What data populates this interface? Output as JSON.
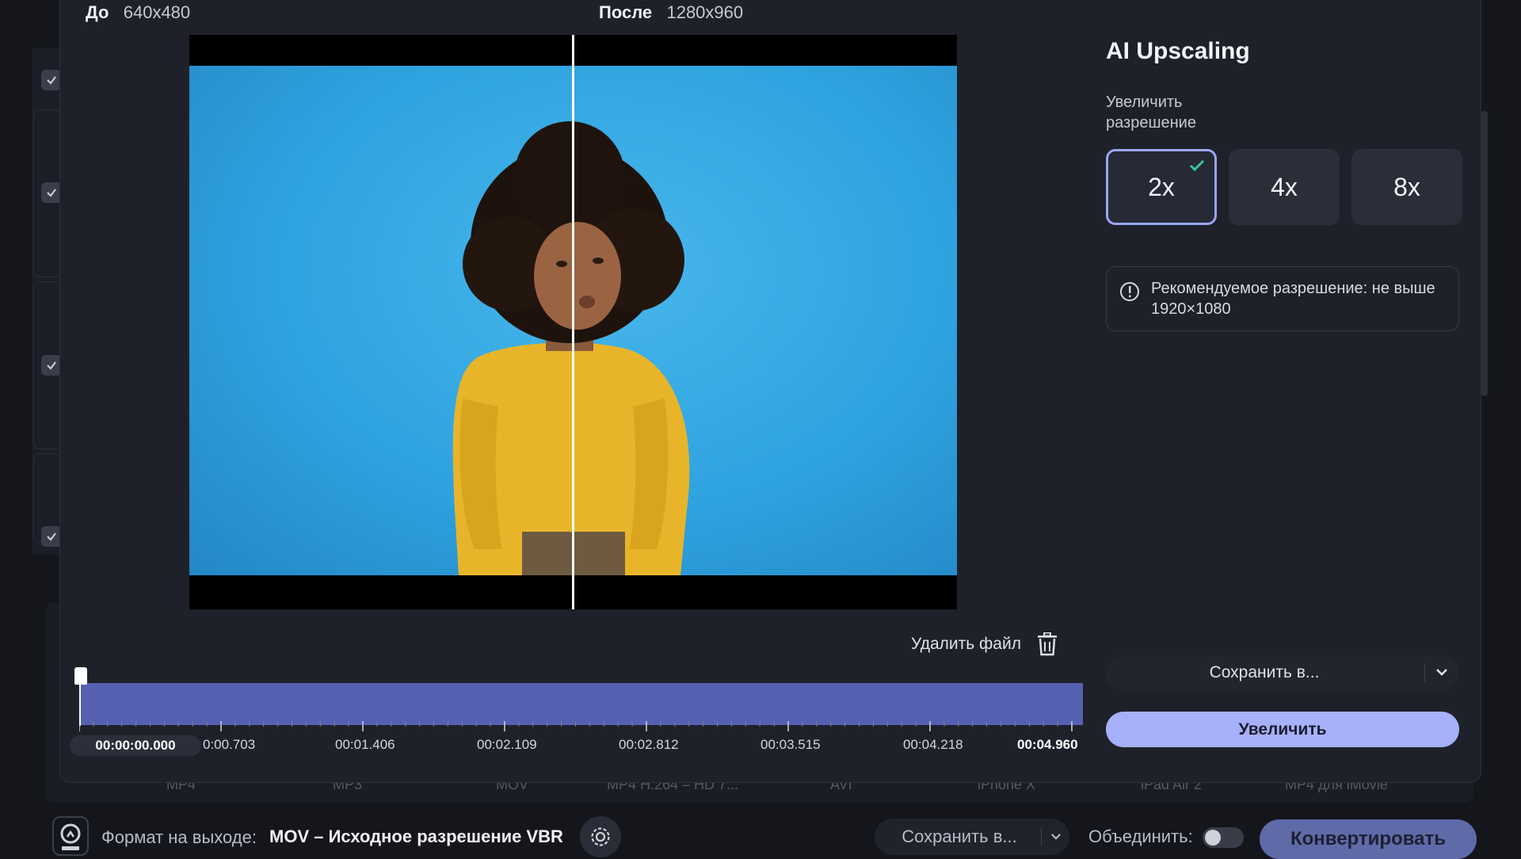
{
  "preview": {
    "before_label": "До",
    "before_resolution": "640x480",
    "after_label": "После",
    "after_resolution": "1280x960"
  },
  "panel": {
    "title": "AI Upscaling",
    "upscale_label": "Увеличить разрешение",
    "scales": [
      "2x",
      "4x",
      "8x"
    ],
    "selected_scale": "2x",
    "info_text": "Рекомендуемое разрешение: не выше 1920×1080",
    "save_to_label": "Сохранить в...",
    "upscale_button": "Увеличить"
  },
  "editor": {
    "delete_file_label": "Удалить файл"
  },
  "timeline": {
    "current_time": "00:00:00.000",
    "labels": [
      "0:00.703",
      "00:01.406",
      "00:02.109",
      "00:02.812",
      "00:03.515",
      "00:04.218",
      "00:04.960"
    ]
  },
  "background_tabs": [
    "MP4",
    "MP3",
    "MOV",
    "MP4 H.264 – HD 7...",
    "AVI",
    "iPhone X",
    "iPad Air 2",
    "MP4 для iMovie"
  ],
  "bottom_bar": {
    "format_label": "Формат на выходе:",
    "format_value": "MOV – Исходное разрешение VBR",
    "save_to_label": "Сохранить в...",
    "merge_label": "Объединить:",
    "convert_button": "Конвертировать"
  },
  "colors": {
    "accent": "#a6b0fb",
    "selected_border": "#9aa5f5",
    "checkmark": "#38c59a",
    "timeline_track": "#5660b0",
    "convert_button": "#5f6aa8"
  }
}
